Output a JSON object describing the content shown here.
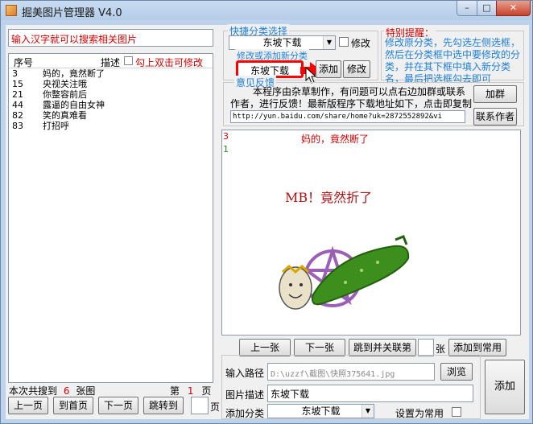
{
  "window": {
    "title": "掘美图片管理器 V4.0",
    "min": "–",
    "max": "□",
    "close": "✕"
  },
  "left": {
    "search_placeholder": "输入汉字就可以搜索相关图片",
    "header": {
      "col_id": "序号",
      "col_desc": "描述",
      "hint": "勾上双击可修改"
    },
    "rows": [
      {
        "id": "3",
        "desc": "妈的，竟然断了"
      },
      {
        "id": "15",
        "desc": "央视关注哦"
      },
      {
        "id": "21",
        "desc": "你整容前后"
      },
      {
        "id": "44",
        "desc": "露逼的自由女神"
      },
      {
        "id": "82",
        "desc": "笑的真难看"
      },
      {
        "id": "83",
        "desc": "打招呼"
      }
    ],
    "count_prefix": "本次共搜到",
    "count_value": "6",
    "count_suffix": "张图",
    "page_prefix": "第",
    "page_value": "1",
    "page_suffix": "页",
    "btn_prev": "上一页",
    "btn_first": "到首页",
    "btn_next": "下一页",
    "btn_jump": "跳转到",
    "page_input": "",
    "page_unit": "页"
  },
  "quick": {
    "group_label": "快捷分类选择",
    "category_selected": "东坡下载",
    "modify_check_label": "修改",
    "modify_label": "修改或添加新分类",
    "category_input": "东坡下载",
    "btn_add": "添加",
    "btn_modify": "修改"
  },
  "notice": {
    "title": "特别提醒：",
    "text": "修改原分类，先勾选左侧选框，然后在分类框中选中要修改的分类，并在其下框中填入新分类名，最后把选框勾去即可"
  },
  "feedback": {
    "label": "意见反馈",
    "text": "本程序由杂草制作，有问题可以点右边加群或联系作者，进行反馈！最新版程序下载地址如下，点击即复制",
    "url": "http://yun.baidu.com/share/home?uk=2872552892&vi",
    "btn_join": "加群",
    "btn_contact": "联系作者"
  },
  "preview": {
    "id": "3",
    "title": "妈的，竟然断了",
    "line_no": "1",
    "image_caption": "MB！竟然折了",
    "btn_prev": "上一张",
    "btn_next": "下一张",
    "btn_jump_related": "跳到并关联第",
    "jump_input": "",
    "jump_unit": "张",
    "btn_add_common": "添加到常用"
  },
  "addform": {
    "path_label": "输入路径",
    "path_value": "D:\\uzzf\\截图\\快照375641.jpg",
    "btn_browse": "浏览",
    "desc_label": "图片描述",
    "desc_value": "东坡下载",
    "category_label": "添加分类",
    "category_value": "东坡下载",
    "common_label": "设置为常用",
    "btn_add": "添加"
  },
  "colors": {
    "hint_red": "#d40000",
    "notice_blue": "#1e7fd6",
    "highlight": "#ff0000"
  }
}
